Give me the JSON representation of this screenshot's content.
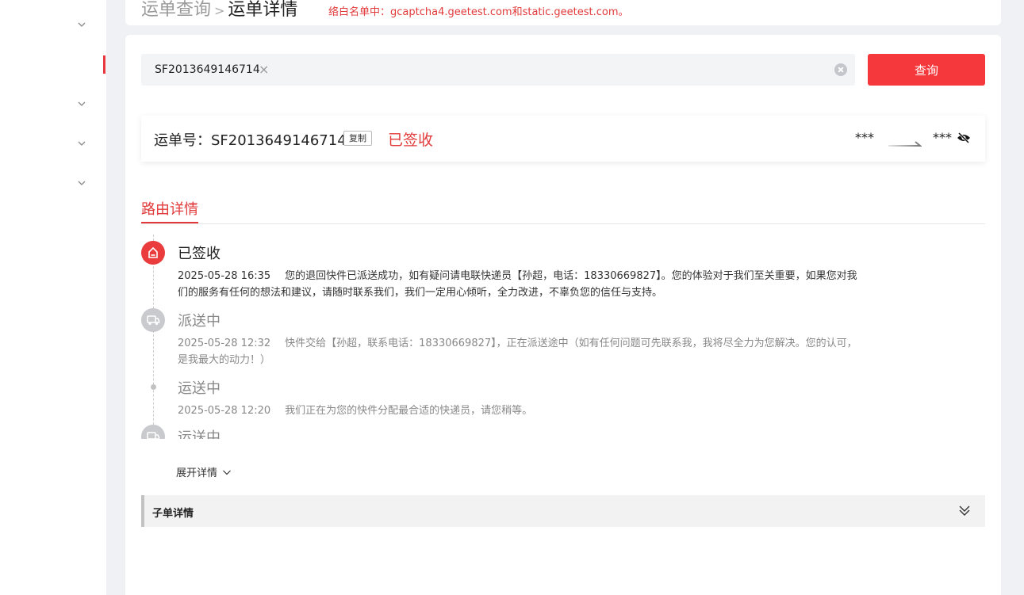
{
  "header": {
    "breadcrumb_parent": "运单查询",
    "breadcrumb_separator": ">",
    "breadcrumb_current": "运单详情",
    "whitelist_note": "络白名单中：gcaptcha4.geetest.com和static.geetest.com。"
  },
  "search": {
    "tag_value": "SF2013649146714",
    "tag_close": "×",
    "query_button": "查询"
  },
  "waybill": {
    "label": "运单号：SF2013649146714",
    "copy_label": "复制",
    "status": "已签收",
    "from_masked": "***",
    "to_masked": "***"
  },
  "tabs": {
    "route_details": "路由详情"
  },
  "timeline": [
    {
      "status": "已签收",
      "time": "2025-05-28 16:35",
      "text": "您的退回快件已派送成功，如有疑问请电联快递员【孙超，电话：18330669827】。您的体验对于我们至关重要，如果您对我们的服务有任何的想法和建议，请随时联系我们，我们一定用心倾听，全力改进，不辜负您的信任与支持。",
      "icon": "signed-home-icon"
    },
    {
      "status": "派送中",
      "time": "2025-05-28 12:32",
      "text": "快件交给【孙超，联系电话：18330669827】，正在派送途中（如有任何问题可先联系我，我将尽全力为您解决。您的认可，是我最大的动力！）",
      "icon": "delivery-truck-icon"
    },
    {
      "status": "运送中",
      "time": "2025-05-28 12:20",
      "text": "我们正在为您的快件分配最合适的快递员，请您稍等。",
      "icon": "timeline-dot"
    },
    {
      "status": "运送中",
      "time": "",
      "text": "",
      "icon": "transit-truck-icon"
    }
  ],
  "expand_label": "展开详情",
  "sub_order": {
    "title": "子单详情"
  },
  "colors": {
    "accent": "#e23a3a",
    "button": "#f5383c",
    "muted": "#888888"
  }
}
